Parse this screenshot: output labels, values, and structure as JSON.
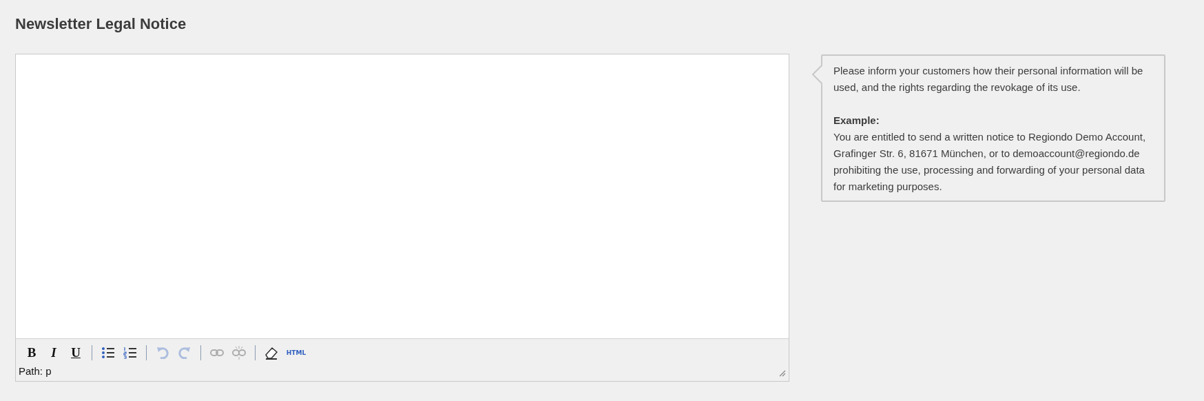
{
  "title": "Newsletter Legal Notice",
  "editor": {
    "toolbar": [
      {
        "kind": "bold",
        "label": "B",
        "disabled": false
      },
      {
        "kind": "italic",
        "label": "I",
        "disabled": false
      },
      {
        "kind": "underline",
        "label": "U",
        "disabled": false
      },
      {
        "kind": "separator"
      },
      {
        "kind": "bullets",
        "disabled": false
      },
      {
        "kind": "numbers",
        "disabled": false
      },
      {
        "kind": "separator"
      },
      {
        "kind": "undo",
        "disabled": true
      },
      {
        "kind": "redo",
        "disabled": true
      },
      {
        "kind": "separator"
      },
      {
        "kind": "link",
        "disabled": true
      },
      {
        "kind": "unlink",
        "disabled": true
      },
      {
        "kind": "separator"
      },
      {
        "kind": "eraser",
        "disabled": false
      },
      {
        "kind": "html",
        "label": "HTML",
        "disabled": false
      }
    ],
    "path": "Path: p"
  },
  "help": {
    "intro": "Please inform your customers how their personal information will be used, and the rights regarding the revokage of its use.",
    "example_heading": "Example:",
    "example": "You are entitled to send a written notice to Regiondo Demo Account, Grafinger Str. 6, 81671 München, or to demoaccount@regiondo.de prohibiting the use, processing and forwarding of your personal data for marketing purposes."
  }
}
